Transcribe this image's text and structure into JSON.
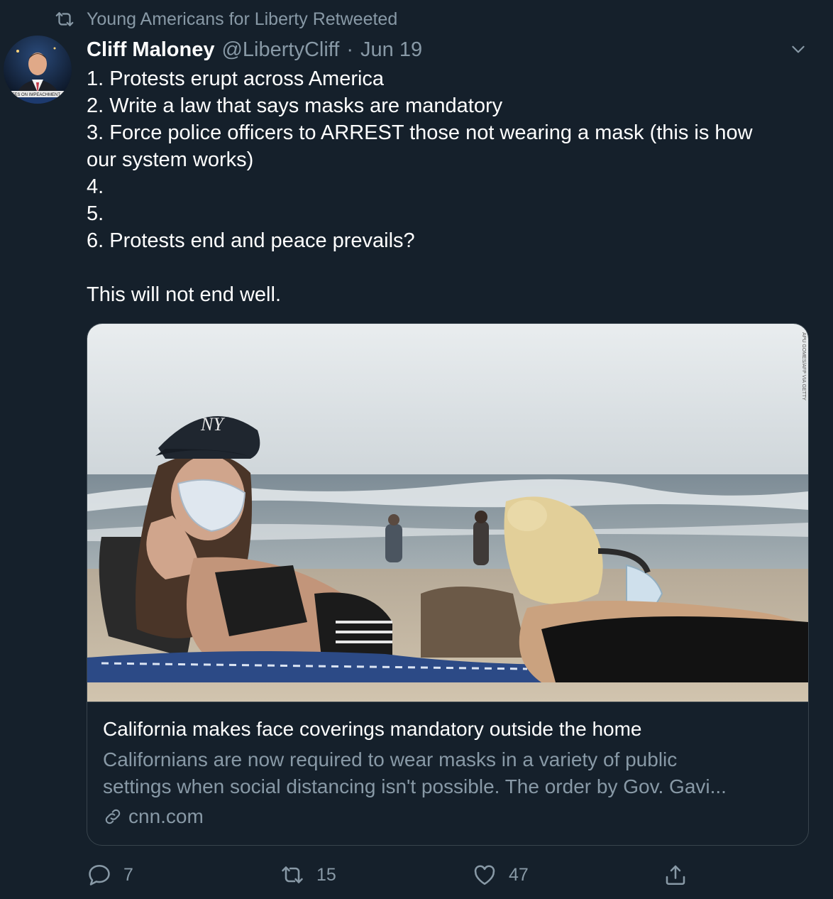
{
  "retweet_notice": {
    "icon": "retweet-icon",
    "text": "Young Americans for Liberty Retweeted"
  },
  "author": {
    "avatar_icon": "avatar",
    "name": "Cliff Maloney",
    "handle": "@LibertyCliff",
    "separator": "·",
    "date": "Jun 19",
    "avatar_banner_text": "VOTES ON IMPEACHMENT A"
  },
  "tweet": {
    "lines": [
      "1. Protests erupt across America",
      "2. Write a law that says masks are mandatory",
      "3. Force police officers to ARREST those not wearing a mask (this is how",
      "our system works)",
      "4.",
      "5.",
      "6. Protests end and peace prevails?",
      "",
      "This will not end well."
    ]
  },
  "link_card": {
    "image_description_icon": "beach-photo",
    "image_credit": "APU GOMES/AFP VIA GETTY",
    "title": "California makes face coverings mandatory outside the home",
    "description_lines": [
      "Californians are now required to wear masks in a variety of public",
      "settings when social distancing isn't possible. The order by Gov. Gavi..."
    ],
    "domain_icon": "link-icon",
    "domain": "cnn.com"
  },
  "actions": {
    "reply_count": "7",
    "retweet_count": "15",
    "like_count": "47"
  },
  "colors": {
    "background": "#15202b",
    "secondary_text": "#8899a6",
    "border": "#38444d"
  }
}
